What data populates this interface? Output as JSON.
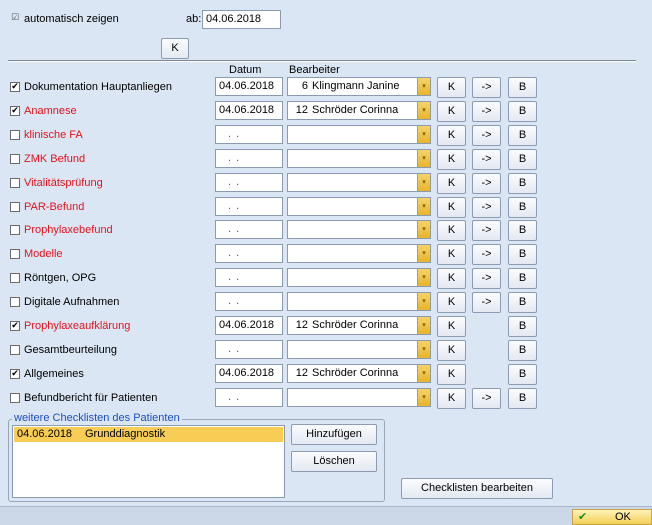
{
  "top": {
    "auto_check": "☑",
    "auto_label": "automatisch zeigen",
    "ab_label": "ab:",
    "ab_date": "04.06.2018",
    "k_button": "K"
  },
  "columns": {
    "datum": "Datum",
    "bearbeiter": "Bearbeiter"
  },
  "rows": [
    {
      "label": "Dokumentation Hauptanliegen",
      "checked": "✔",
      "red": false,
      "date": "04.06.2018",
      "num": "6",
      "name": "Klingmann Janine",
      "k": "K",
      "arrow": "->",
      "b": "B"
    },
    {
      "label": "Anamnese",
      "checked": "✔",
      "red": true,
      "date": "04.06.2018",
      "num": "12",
      "name": "Schröder Corinna",
      "k": "K",
      "arrow": "->",
      "b": "B"
    },
    {
      "label": "klinische FA",
      "checked": "",
      "red": true,
      "date": ". .",
      "num": "",
      "name": "",
      "k": "K",
      "arrow": "->",
      "b": "B"
    },
    {
      "label": "ZMK Befund",
      "checked": "",
      "red": true,
      "date": ". .",
      "num": "",
      "name": "",
      "k": "K",
      "arrow": "->",
      "b": "B"
    },
    {
      "label": "Vitalitätsprüfung",
      "checked": "",
      "red": true,
      "date": ". .",
      "num": "",
      "name": "",
      "k": "K",
      "arrow": "->",
      "b": "B"
    },
    {
      "label": "PAR-Befund",
      "checked": "",
      "red": true,
      "date": ". .",
      "num": "",
      "name": "",
      "k": "K",
      "arrow": "->",
      "b": "B"
    },
    {
      "label": "Prophylaxebefund",
      "checked": "",
      "red": true,
      "date": ". .",
      "num": "",
      "name": "",
      "k": "K",
      "arrow": "->",
      "b": "B"
    },
    {
      "label": "Modelle",
      "checked": "",
      "red": true,
      "date": ". .",
      "num": "",
      "name": "",
      "k": "K",
      "arrow": "->",
      "b": "B"
    },
    {
      "label": "Röntgen, OPG",
      "checked": "",
      "red": false,
      "date": ". .",
      "num": "",
      "name": "",
      "k": "K",
      "arrow": "->",
      "b": "B"
    },
    {
      "label": "Digitale Aufnahmen",
      "checked": "",
      "red": false,
      "date": ". .",
      "num": "",
      "name": "",
      "k": "K",
      "arrow": "->",
      "b": "B"
    },
    {
      "label": "Prophylaxeaufklärung",
      "checked": "✔",
      "red": true,
      "date": "04.06.2018",
      "num": "12",
      "name": "Schröder Corinna",
      "k": "K",
      "arrow": "",
      "b": "B"
    },
    {
      "label": "Gesamtbeurteilung",
      "checked": "",
      "red": false,
      "date": ". .",
      "num": "",
      "name": "",
      "k": "K",
      "arrow": "",
      "b": "B"
    },
    {
      "label": "Allgemeines",
      "checked": "✔",
      "red": false,
      "date": "04.06.2018",
      "num": "12",
      "name": "Schröder Corinna",
      "k": "K",
      "arrow": "",
      "b": "B"
    },
    {
      "label": "Befundbericht für Patienten",
      "checked": "",
      "red": false,
      "date": ". .",
      "num": "",
      "name": "",
      "k": "K",
      "arrow": "->",
      "b": "B"
    }
  ],
  "checklists": {
    "title": "weitere Checklisten des Patienten",
    "items": [
      {
        "date": "04.06.2018",
        "name": "Grunddiagnostik"
      }
    ],
    "add_button": "Hinzufügen",
    "delete_button": "Löschen",
    "edit_button": "Checklisten bearbeiten"
  },
  "footer": {
    "ok_icon": "✔",
    "ok_label": "OK"
  },
  "colors": {
    "red_label": "#e0141e",
    "combo_arrow": "#e8b429",
    "selected_row": "#f7cd55"
  }
}
